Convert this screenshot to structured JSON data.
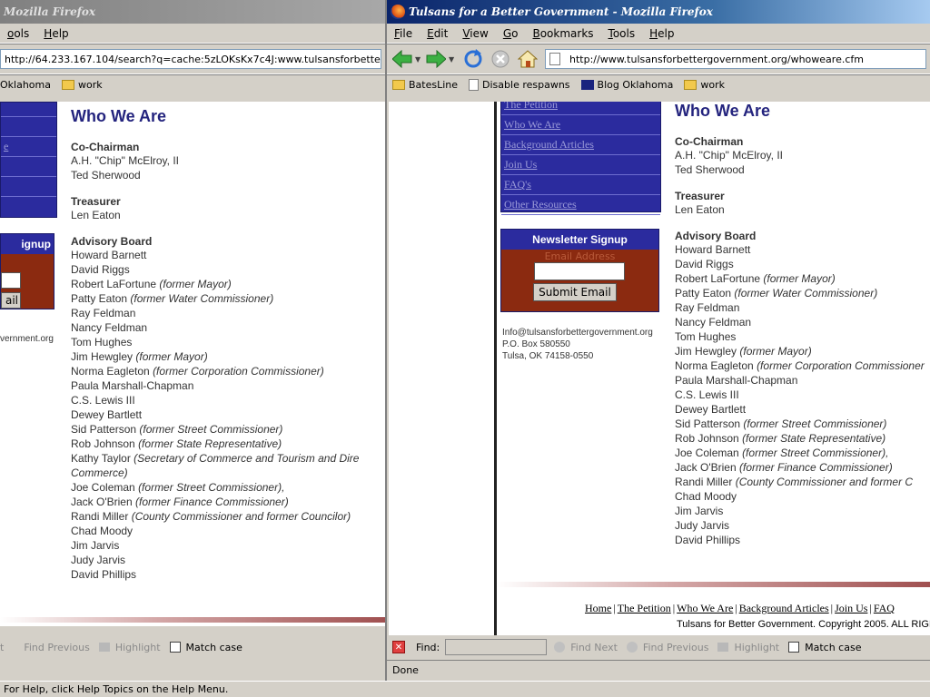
{
  "left": {
    "title": "Mozilla Firefox",
    "menu": [
      "ools",
      "Help"
    ],
    "url": "http://64.233.167.104/search?q=cache:5zLOKsKx7c4J:www.tulsansforbettergovernment.o",
    "bookmarks": [
      "Oklahoma",
      "work"
    ],
    "heading": "Who We Are",
    "nav_fragment": "e",
    "signup_fragment": "ignup",
    "email_fragment": "ail",
    "contact_fragment": "vernment.org",
    "find": {
      "prev": "Find Previous",
      "highlight": "Highlight",
      "match_case": "Match case",
      "cut": "t"
    }
  },
  "right": {
    "title": "Tulsans for a Better Government - Mozilla Firefox",
    "menu": [
      "File",
      "Edit",
      "View",
      "Go",
      "Bookmarks",
      "Tools",
      "Help"
    ],
    "url": "http://www.tulsansforbettergovernment.org/whoweare.cfm",
    "bookmarks": [
      "BatesLine",
      "Disable respawns",
      "Blog Oklahoma",
      "work"
    ],
    "heading": "Who We Are",
    "nav_items": [
      "The Petition",
      "Who We Are",
      "Background Articles",
      "Join Us",
      "FAQ's",
      "Other Resources"
    ],
    "newsletter": {
      "title": "Newsletter Signup",
      "placeholder": "Email Address",
      "button": "Submit Email"
    },
    "contact": [
      "Info@tulsansforbettergovernment.org",
      "P.O. Box 580550",
      "Tulsa, OK 74158-0550"
    ],
    "footer_links": [
      "Home",
      "The Petition",
      "Who We Are",
      "Background Articles",
      "Join Us",
      "FAQ"
    ],
    "copyright": "Tulsans for Better Government. Copyright 2005. ALL RIGH",
    "find": {
      "label": "Find:",
      "next": "Find Next",
      "prev": "Find Previous",
      "highlight": "Highlight",
      "match_case": "Match case"
    },
    "status": "Done"
  },
  "roster": {
    "cochair_title": "Co-Chairman",
    "cochairs": [
      "A.H. \"Chip\" McElroy, II",
      "Ted Sherwood"
    ],
    "treasurer_title": "Treasurer",
    "treasurer": "Len Eaton",
    "advisory_title": "Advisory Board",
    "left_board": [
      {
        "name": "Howard Barnett",
        "note": ""
      },
      {
        "name": "David Riggs",
        "note": ""
      },
      {
        "name": "Robert LaFortune",
        "note": "(former Mayor)"
      },
      {
        "name": "Patty Eaton",
        "note": "(former Water Commissioner)"
      },
      {
        "name": "Ray Feldman",
        "note": ""
      },
      {
        "name": "Nancy Feldman",
        "note": ""
      },
      {
        "name": "Tom Hughes",
        "note": ""
      },
      {
        "name": "Jim Hewgley",
        "note": "(former Mayor)"
      },
      {
        "name": "Norma Eagleton",
        "note": "(former Corporation Commissioner)"
      },
      {
        "name": "Paula Marshall-Chapman",
        "note": ""
      },
      {
        "name": "C.S. Lewis III",
        "note": ""
      },
      {
        "name": "Dewey Bartlett",
        "note": ""
      },
      {
        "name": "Sid Patterson",
        "note": "(former Street Commissioner)"
      },
      {
        "name": "Rob Johnson",
        "note": "(former State Representative)"
      },
      {
        "name": "Kathy Taylor",
        "note": "(Secretary of Commerce and Tourism and Dire"
      },
      {
        "name": "",
        "note": "Commerce)"
      },
      {
        "name": "Joe Coleman",
        "note": "(former Street Commissioner),"
      },
      {
        "name": "Jack O'Brien",
        "note": "(former Finance Commissioner)"
      },
      {
        "name": "Randi Miller",
        "note": "(County Commissioner and former Councilor)"
      },
      {
        "name": "Chad Moody",
        "note": ""
      },
      {
        "name": "Jim Jarvis",
        "note": ""
      },
      {
        "name": "Judy Jarvis",
        "note": ""
      },
      {
        "name": "David Phillips",
        "note": ""
      }
    ],
    "right_board": [
      {
        "name": "Howard Barnett",
        "note": ""
      },
      {
        "name": "David Riggs",
        "note": ""
      },
      {
        "name": "Robert LaFortune",
        "note": "(former Mayor)"
      },
      {
        "name": "Patty Eaton",
        "note": "(former Water Commissioner)"
      },
      {
        "name": "Ray Feldman",
        "note": ""
      },
      {
        "name": "Nancy Feldman",
        "note": ""
      },
      {
        "name": "Tom Hughes",
        "note": ""
      },
      {
        "name": "Jim Hewgley",
        "note": "(former Mayor)"
      },
      {
        "name": "Norma Eagleton",
        "note": "(former Corporation Commissioner"
      },
      {
        "name": "Paula Marshall-Chapman",
        "note": ""
      },
      {
        "name": "C.S. Lewis III",
        "note": ""
      },
      {
        "name": "Dewey Bartlett",
        "note": ""
      },
      {
        "name": "Sid Patterson",
        "note": "(former Street Commissioner)"
      },
      {
        "name": "Rob Johnson",
        "note": "(former State Representative)"
      },
      {
        "name": "Joe Coleman",
        "note": "(former Street Commissioner),"
      },
      {
        "name": "Jack O'Brien",
        "note": "(former Finance Commissioner)"
      },
      {
        "name": "Randi Miller",
        "note": "(County Commissioner and former C"
      },
      {
        "name": "Chad Moody",
        "note": ""
      },
      {
        "name": "Jim Jarvis",
        "note": ""
      },
      {
        "name": "Judy Jarvis",
        "note": ""
      },
      {
        "name": "David Phillips",
        "note": ""
      }
    ]
  },
  "bottom_status": "For Help, click Help Topics on the Help Menu."
}
